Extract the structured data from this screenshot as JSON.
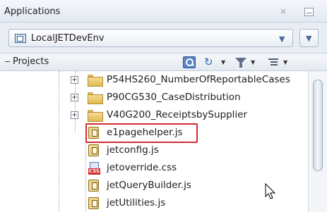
{
  "window": {
    "title": "Applications",
    "close_glyph": "×",
    "minimize_icon": "minimize-icon"
  },
  "app_selector": {
    "selected": "LocalJETDevEnv",
    "icon": "application-icon",
    "arrow": "▼",
    "menu_arrow": "▼"
  },
  "projects_panel": {
    "collapse_glyph": "−",
    "label": "Projects",
    "toolbar": {
      "search_icon": "search-icon",
      "sync_icon": "sync-icon",
      "filter_icon": "filter-icon",
      "list_icon": "list-options-icon",
      "dropdown_glyph": "▼"
    }
  },
  "tree": {
    "expander_glyph": "+",
    "folders": [
      {
        "name": "P54HS260_NumberOfReportableCases"
      },
      {
        "name": "P90CG530_CaseDistribution"
      },
      {
        "name": "V40G200_ReceiptsbySupplier"
      }
    ],
    "files": [
      {
        "name": "e1pagehelper.js",
        "type": "js",
        "highlighted": true
      },
      {
        "name": "jetconfig.js",
        "type": "js"
      },
      {
        "name": "jetoverride.css",
        "type": "css",
        "badge": "CSS"
      },
      {
        "name": "jetQueryBuilder.js",
        "type": "js"
      },
      {
        "name": "jetUtilities.js",
        "type": "js"
      }
    ]
  },
  "colors": {
    "highlight": "#d42a2f",
    "folder": "#e1b956",
    "css_badge": "#d12a2a"
  }
}
